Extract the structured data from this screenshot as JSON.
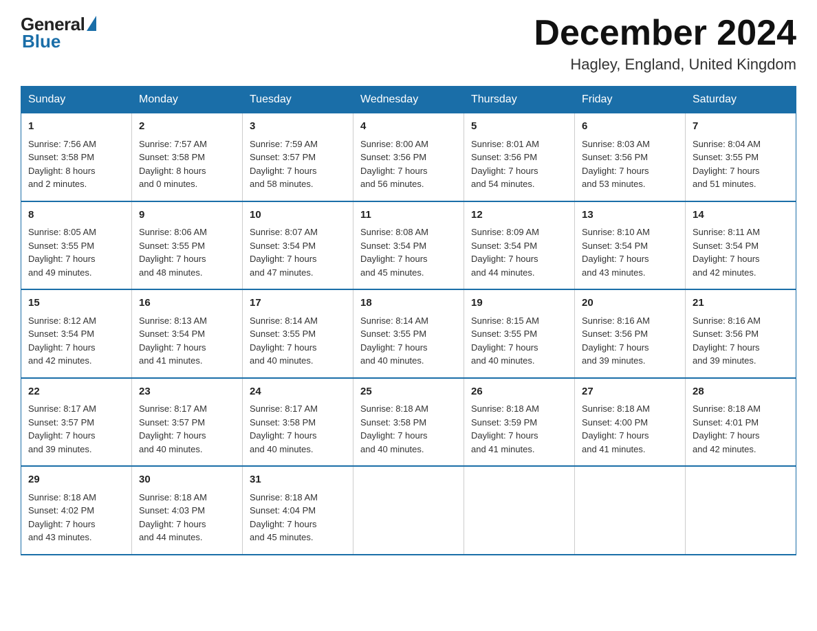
{
  "header": {
    "logo_general": "General",
    "logo_blue": "Blue",
    "month_title": "December 2024",
    "location": "Hagley, England, United Kingdom"
  },
  "days_of_week": [
    "Sunday",
    "Monday",
    "Tuesday",
    "Wednesday",
    "Thursday",
    "Friday",
    "Saturday"
  ],
  "weeks": [
    [
      {
        "num": "1",
        "info": "Sunrise: 7:56 AM\nSunset: 3:58 PM\nDaylight: 8 hours\nand 2 minutes."
      },
      {
        "num": "2",
        "info": "Sunrise: 7:57 AM\nSunset: 3:58 PM\nDaylight: 8 hours\nand 0 minutes."
      },
      {
        "num": "3",
        "info": "Sunrise: 7:59 AM\nSunset: 3:57 PM\nDaylight: 7 hours\nand 58 minutes."
      },
      {
        "num": "4",
        "info": "Sunrise: 8:00 AM\nSunset: 3:56 PM\nDaylight: 7 hours\nand 56 minutes."
      },
      {
        "num": "5",
        "info": "Sunrise: 8:01 AM\nSunset: 3:56 PM\nDaylight: 7 hours\nand 54 minutes."
      },
      {
        "num": "6",
        "info": "Sunrise: 8:03 AM\nSunset: 3:56 PM\nDaylight: 7 hours\nand 53 minutes."
      },
      {
        "num": "7",
        "info": "Sunrise: 8:04 AM\nSunset: 3:55 PM\nDaylight: 7 hours\nand 51 minutes."
      }
    ],
    [
      {
        "num": "8",
        "info": "Sunrise: 8:05 AM\nSunset: 3:55 PM\nDaylight: 7 hours\nand 49 minutes."
      },
      {
        "num": "9",
        "info": "Sunrise: 8:06 AM\nSunset: 3:55 PM\nDaylight: 7 hours\nand 48 minutes."
      },
      {
        "num": "10",
        "info": "Sunrise: 8:07 AM\nSunset: 3:54 PM\nDaylight: 7 hours\nand 47 minutes."
      },
      {
        "num": "11",
        "info": "Sunrise: 8:08 AM\nSunset: 3:54 PM\nDaylight: 7 hours\nand 45 minutes."
      },
      {
        "num": "12",
        "info": "Sunrise: 8:09 AM\nSunset: 3:54 PM\nDaylight: 7 hours\nand 44 minutes."
      },
      {
        "num": "13",
        "info": "Sunrise: 8:10 AM\nSunset: 3:54 PM\nDaylight: 7 hours\nand 43 minutes."
      },
      {
        "num": "14",
        "info": "Sunrise: 8:11 AM\nSunset: 3:54 PM\nDaylight: 7 hours\nand 42 minutes."
      }
    ],
    [
      {
        "num": "15",
        "info": "Sunrise: 8:12 AM\nSunset: 3:54 PM\nDaylight: 7 hours\nand 42 minutes."
      },
      {
        "num": "16",
        "info": "Sunrise: 8:13 AM\nSunset: 3:54 PM\nDaylight: 7 hours\nand 41 minutes."
      },
      {
        "num": "17",
        "info": "Sunrise: 8:14 AM\nSunset: 3:55 PM\nDaylight: 7 hours\nand 40 minutes."
      },
      {
        "num": "18",
        "info": "Sunrise: 8:14 AM\nSunset: 3:55 PM\nDaylight: 7 hours\nand 40 minutes."
      },
      {
        "num": "19",
        "info": "Sunrise: 8:15 AM\nSunset: 3:55 PM\nDaylight: 7 hours\nand 40 minutes."
      },
      {
        "num": "20",
        "info": "Sunrise: 8:16 AM\nSunset: 3:56 PM\nDaylight: 7 hours\nand 39 minutes."
      },
      {
        "num": "21",
        "info": "Sunrise: 8:16 AM\nSunset: 3:56 PM\nDaylight: 7 hours\nand 39 minutes."
      }
    ],
    [
      {
        "num": "22",
        "info": "Sunrise: 8:17 AM\nSunset: 3:57 PM\nDaylight: 7 hours\nand 39 minutes."
      },
      {
        "num": "23",
        "info": "Sunrise: 8:17 AM\nSunset: 3:57 PM\nDaylight: 7 hours\nand 40 minutes."
      },
      {
        "num": "24",
        "info": "Sunrise: 8:17 AM\nSunset: 3:58 PM\nDaylight: 7 hours\nand 40 minutes."
      },
      {
        "num": "25",
        "info": "Sunrise: 8:18 AM\nSunset: 3:58 PM\nDaylight: 7 hours\nand 40 minutes."
      },
      {
        "num": "26",
        "info": "Sunrise: 8:18 AM\nSunset: 3:59 PM\nDaylight: 7 hours\nand 41 minutes."
      },
      {
        "num": "27",
        "info": "Sunrise: 8:18 AM\nSunset: 4:00 PM\nDaylight: 7 hours\nand 41 minutes."
      },
      {
        "num": "28",
        "info": "Sunrise: 8:18 AM\nSunset: 4:01 PM\nDaylight: 7 hours\nand 42 minutes."
      }
    ],
    [
      {
        "num": "29",
        "info": "Sunrise: 8:18 AM\nSunset: 4:02 PM\nDaylight: 7 hours\nand 43 minutes."
      },
      {
        "num": "30",
        "info": "Sunrise: 8:18 AM\nSunset: 4:03 PM\nDaylight: 7 hours\nand 44 minutes."
      },
      {
        "num": "31",
        "info": "Sunrise: 8:18 AM\nSunset: 4:04 PM\nDaylight: 7 hours\nand 45 minutes."
      },
      null,
      null,
      null,
      null
    ]
  ]
}
